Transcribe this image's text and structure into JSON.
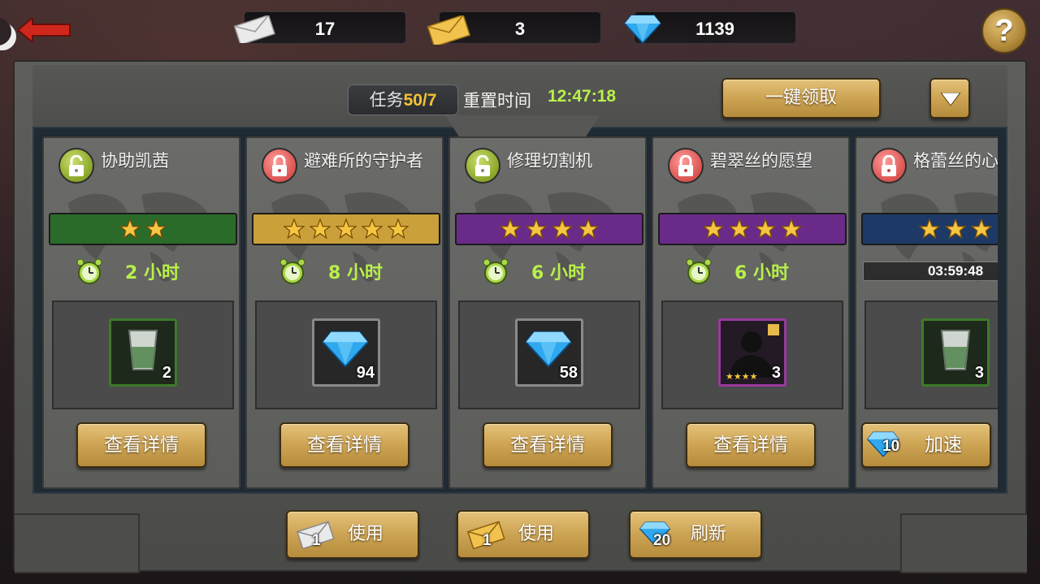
{
  "resources": {
    "white_letter": "17",
    "gold_letter": "3",
    "diamonds": "1139"
  },
  "help_label": "?",
  "header": {
    "task_label": "任务",
    "task_count": "50/7",
    "reset_label": "重置时间",
    "reset_time": "12:47:18",
    "claim_all": "一键领取"
  },
  "cards": [
    {
      "title": "协助凯茜",
      "locked": false,
      "stars": 2,
      "rarity_color": "#2a6b2a",
      "duration": "2 小时",
      "reward": "cup",
      "reward_count": "2",
      "button": "查看详情"
    },
    {
      "title": "避难所的守护者",
      "locked": true,
      "stars": 5,
      "rarity_color": "#c9a03a",
      "duration": "8 小时",
      "reward": "diamond",
      "reward_count": "94",
      "button": "查看详情"
    },
    {
      "title": "修理切割机",
      "locked": false,
      "stars": 4,
      "rarity_color": "#6a2a8a",
      "duration": "6 小时",
      "reward": "diamond",
      "reward_count": "58",
      "button": "查看详情"
    },
    {
      "title": "碧翠丝的愿望",
      "locked": true,
      "stars": 4,
      "rarity_color": "#6a2a8a",
      "duration": "6 小时",
      "reward": "hero",
      "reward_count": "3",
      "button": "查看详情"
    },
    {
      "title": "格蕾丝的心",
      "locked": true,
      "stars": 3,
      "rarity_color": "#1d3a66",
      "timer": "03:59:48",
      "reward": "cup",
      "reward_count": "3",
      "speed_cost": "10",
      "button": "加速"
    }
  ],
  "bottom": {
    "use_white": {
      "count": "1",
      "label": "使用"
    },
    "use_gold": {
      "count": "1",
      "label": "使用"
    },
    "refresh": {
      "count": "20",
      "label": "刷新"
    }
  }
}
